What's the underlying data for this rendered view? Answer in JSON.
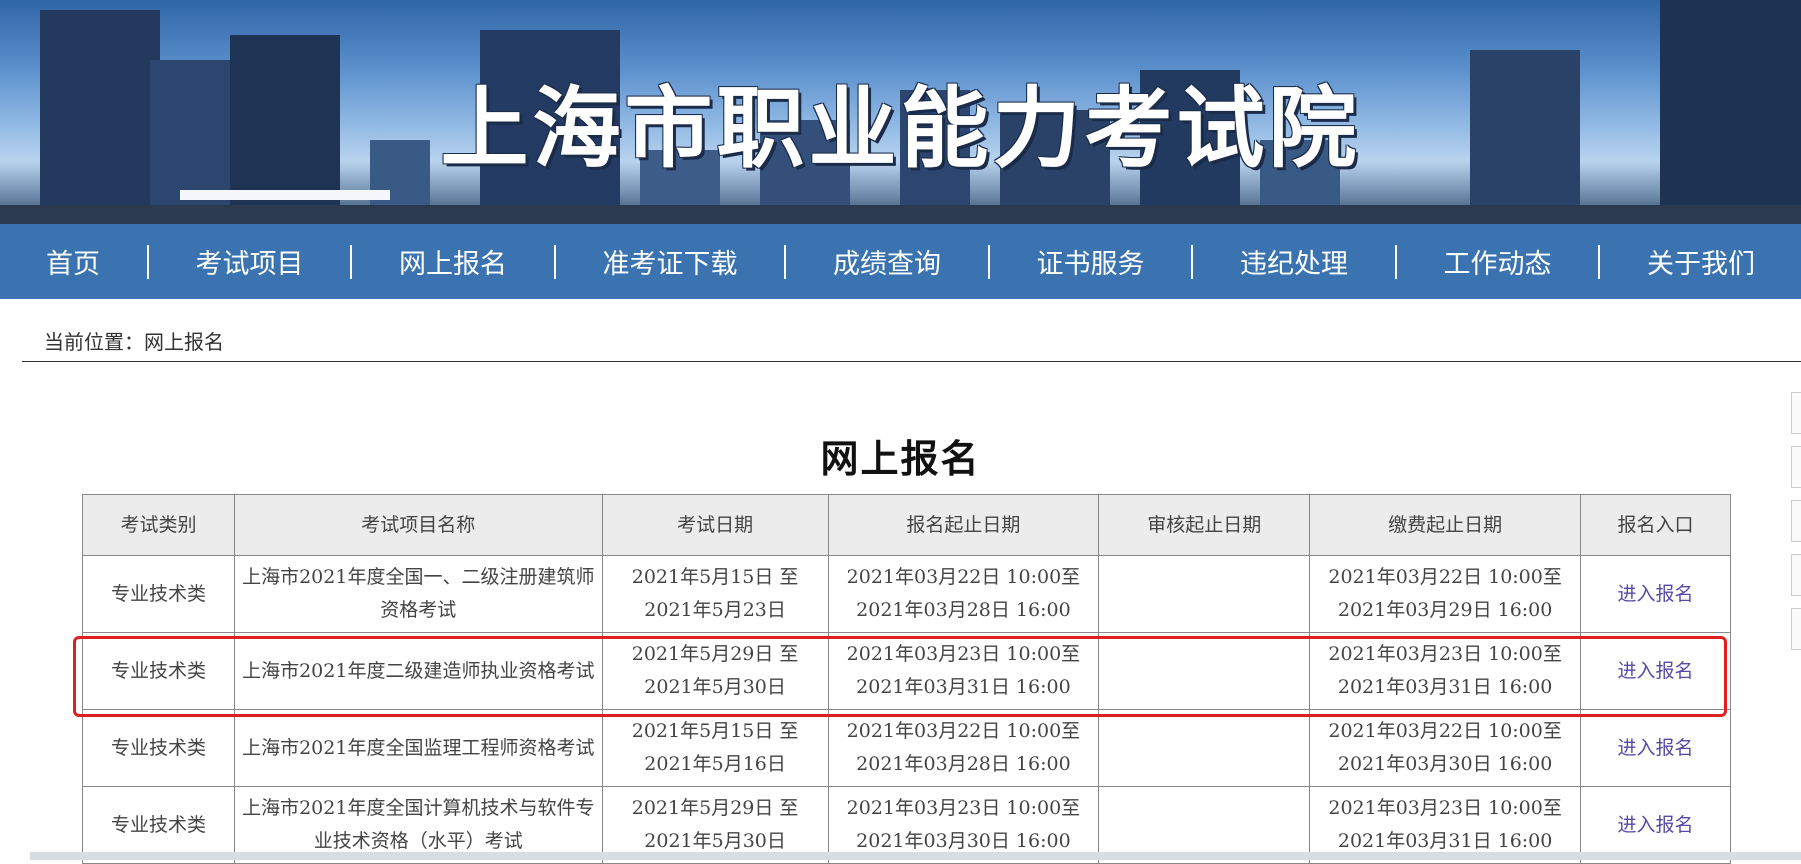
{
  "banner": {
    "title": "上海市职业能力考试院"
  },
  "nav": [
    "首页",
    "考试项目",
    "网上报名",
    "准考证下载",
    "成绩查询",
    "证书服务",
    "违纪处理",
    "工作动态",
    "关于我们"
  ],
  "breadcrumb": "当前位置：网上报名",
  "page_title": "网上报名",
  "table": {
    "headers": [
      "考试类别",
      "考试项目名称",
      "考试日期",
      "报名起止日期",
      "审核起止日期",
      "缴费起止日期",
      "报名入口"
    ],
    "rows": [
      [
        "专业技术类",
        "上海市2021年度全国一、二级注册建筑师资格考试",
        "2021年5月15日 至 2021年5月23日",
        "2021年03月22日 10:00至2021年03月28日 16:00",
        "",
        "2021年03月22日 10:00至2021年03月29日 16:00",
        "进入报名"
      ],
      [
        "专业技术类",
        "上海市2021年度二级建造师执业资格考试",
        "2021年5月29日 至 2021年5月30日",
        "2021年03月23日 10:00至2021年03月31日 16:00",
        "",
        "2021年03月23日 10:00至2021年03月31日 16:00",
        "进入报名"
      ],
      [
        "专业技术类",
        "上海市2021年度全国监理工程师资格考试",
        "2021年5月15日 至 2021年5月16日",
        "2021年03月22日 10:00至2021年03月28日 16:00",
        "",
        "2021年03月22日 10:00至2021年03月30日 16:00",
        "进入报名"
      ],
      [
        "专业技术类",
        "上海市2021年度全国计算机技术与软件专业技术资格（水平）考试",
        "2021年5月29日 至 2021年5月30日",
        "2021年03月23日 10:00至2021年03月30日 16:00",
        "",
        "2021年03月23日 10:00至2021年03月31日 16:00",
        "进入报名"
      ]
    ]
  },
  "colors": {
    "nav_bg": "#3a73b0",
    "highlight": "#e02020",
    "link": "#5a4aa8"
  }
}
